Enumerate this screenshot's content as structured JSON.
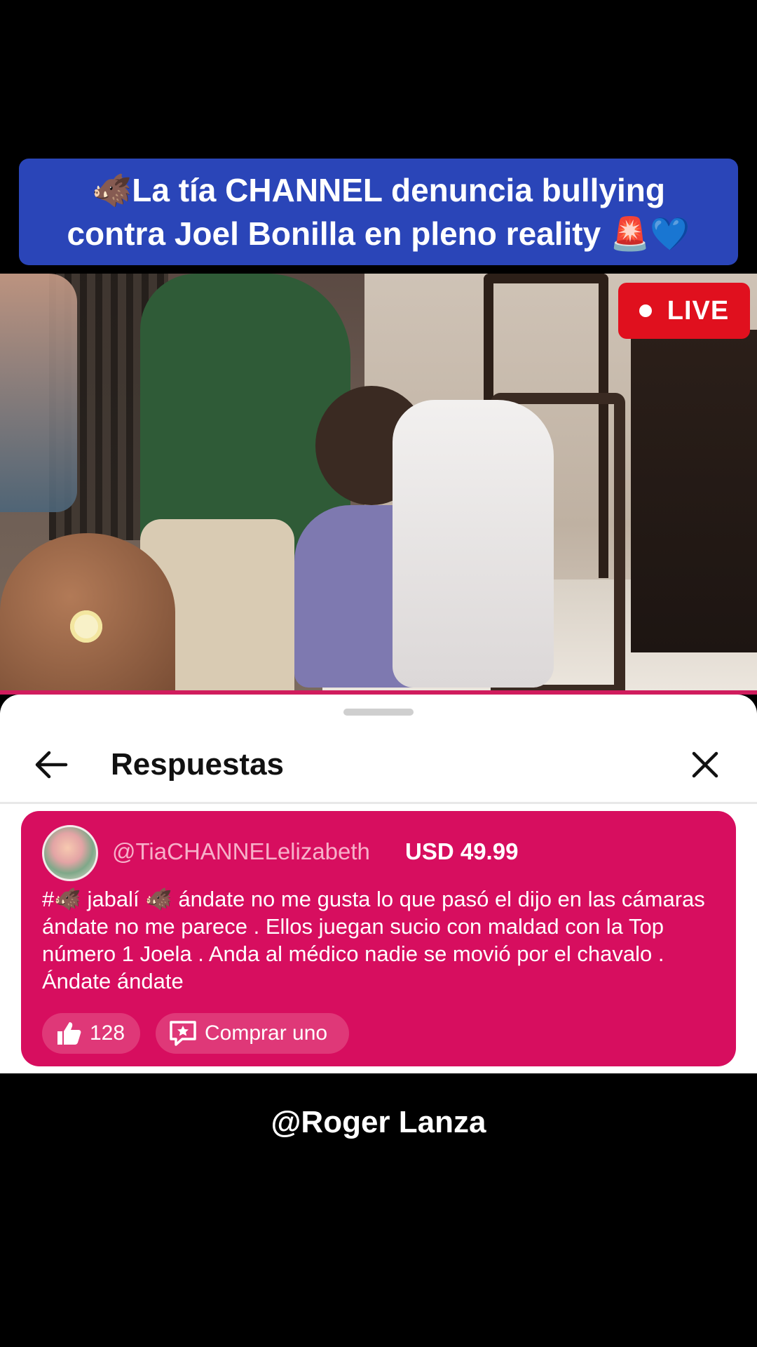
{
  "headline": {
    "line1": "🐗La tía CHANNEL denuncia bullying",
    "line2": "contra Joel Bonilla en pleno reality 🚨💙"
  },
  "video": {
    "live_label": "LIVE"
  },
  "sheet": {
    "title": "Respuestas"
  },
  "comment": {
    "username": "@TiaCHANNELelizabeth",
    "amount": "USD 49.99",
    "text": "#🐗 jabalí 🐗 ándate no me gusta lo que pasó el dijo en las cámaras ándate no me parece . Ellos juegan sucio con maldad con la Top número 1 Joela . Anda al médico nadie se movió por el chavalo . Ándate ándate",
    "like_count": "128",
    "buy_label": "Comprar uno"
  },
  "watermark": "@Roger Lanza",
  "colors": {
    "headline_bg": "#2a45b8",
    "card_bg": "#d70e5f",
    "live_bg": "#e0101e"
  },
  "icons": [
    "back-arrow-icon",
    "close-icon",
    "thumbs-up-icon",
    "gift-star-icon"
  ]
}
